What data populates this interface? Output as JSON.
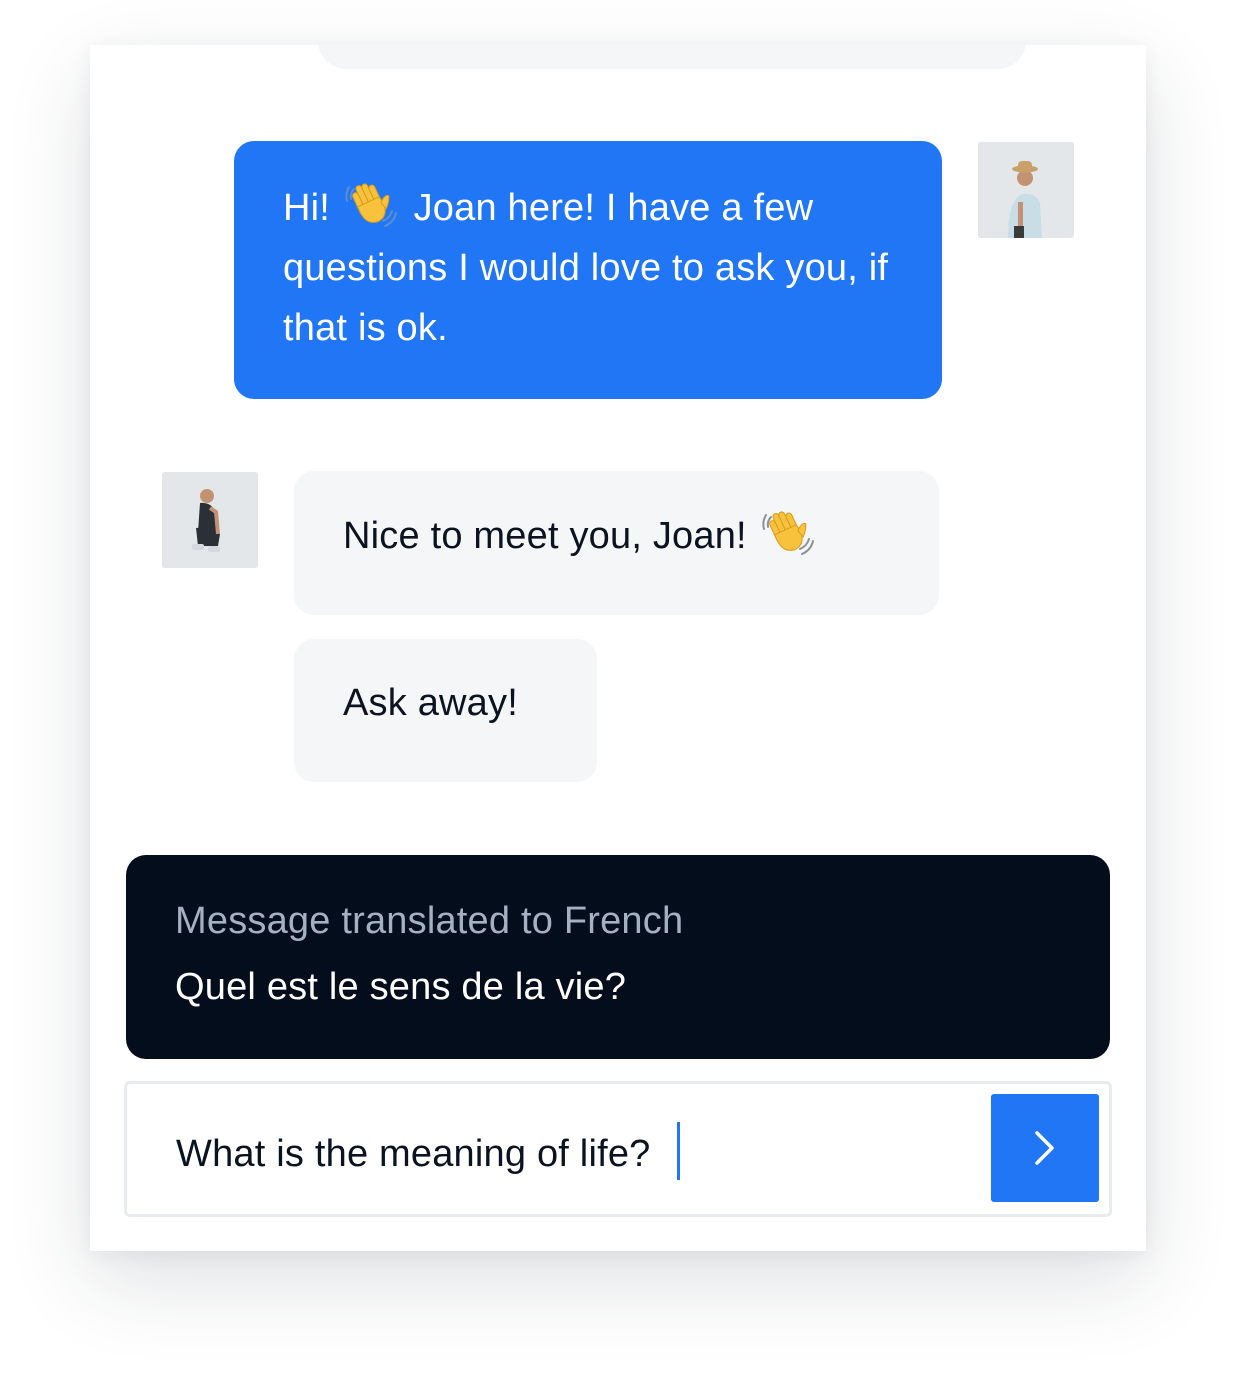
{
  "conversation": {
    "messages": [
      {
        "sender": "Joan",
        "direction": "outgoing",
        "parts": [
          "Hi!",
          "Joan here! I have a few questions I would love to ask you, if that is ok."
        ],
        "emoji": "waving-hand"
      },
      {
        "sender": "agent",
        "direction": "incoming",
        "text": "Nice to meet you, Joan!",
        "emoji": "waving-hand"
      },
      {
        "sender": "agent",
        "direction": "incoming",
        "text": "Ask away!"
      }
    ]
  },
  "translation": {
    "caption": "Message translated to French",
    "text": "Quel est le sens de la vie?"
  },
  "composer": {
    "value": "What is the meaning of life?",
    "send_icon": "chevron-right-icon"
  },
  "colors": {
    "accent": "#2176f5",
    "incoming_bubble": "#f5f6f8",
    "translation_bg": "#040d1b",
    "caption_text": "#a5b0c3",
    "text_dark": "#0b1320"
  }
}
